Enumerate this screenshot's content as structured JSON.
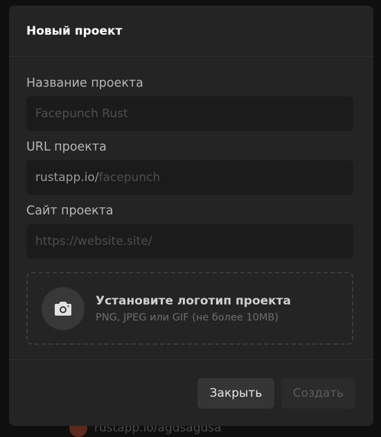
{
  "backdrop": {
    "link_text": "rustapp.io/agdsagdsa"
  },
  "modal": {
    "title": "Новый проект",
    "fields": {
      "name": {
        "label": "Название проекта",
        "value": "",
        "placeholder": "Facepunch Rust"
      },
      "url": {
        "label": "URL проекта",
        "prefix": "rustapp.io/",
        "value": "",
        "placeholder": "facepunch"
      },
      "site": {
        "label": "Сайт проекта",
        "value": "",
        "placeholder": "https://website.site/"
      }
    },
    "logo_upload": {
      "icon": "camera-icon",
      "title": "Установите логотип проекта",
      "subtitle": "PNG, JPEG или GIF (не более 10MB)"
    },
    "buttons": {
      "close_label": "Закрыть",
      "create_label": "Создать",
      "create_disabled": true
    }
  }
}
